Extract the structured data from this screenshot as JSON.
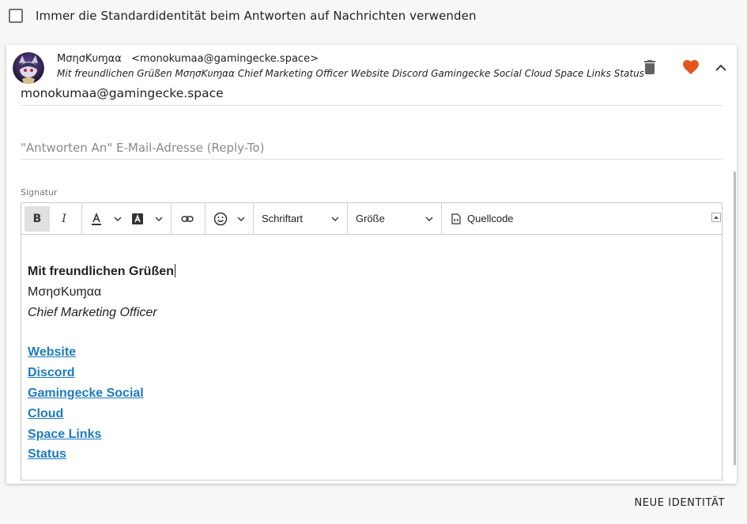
{
  "options": {
    "always_default_identity": "Immer die Standardidentität beim Antworten auf Nachrichten verwenden"
  },
  "identity": {
    "display_name": "ΜσησΚυɱαα",
    "email_header": "<monokumaa@gamingecke.space>",
    "signature_preview": "Mit freundlichen Grüßen ΜσησΚυɱαα Chief Marketing Officer Website Discord Gamingecke Social Cloud Space Links Status",
    "email_value": "monokumaa@gamingecke.space",
    "replyto_placeholder": "\"Antworten An\" E-Mail-Adresse (Reply-To)"
  },
  "icons": {
    "delete": "trash-icon",
    "favorite": "heart-icon",
    "collapse": "chevron-up-icon",
    "accent": "#e2561d"
  },
  "signature": {
    "label": "Signatur",
    "toolbar": {
      "bold": "B",
      "italic": "I",
      "font_select": "Schriftart",
      "size_select": "Größe",
      "source": "Quellcode"
    },
    "body": {
      "greeting": "Mit freundlichen Grüßen",
      "name": "ΜσησΚυɱαα",
      "title": "Chief Marketing Officer",
      "links": [
        "Website",
        "Discord",
        "Gamingecke Social",
        "Cloud",
        "Space Links",
        "Status"
      ],
      "link_color": "#1d7bbf"
    }
  },
  "footer": {
    "new_identity": "NEUE IDENTITÄT"
  }
}
